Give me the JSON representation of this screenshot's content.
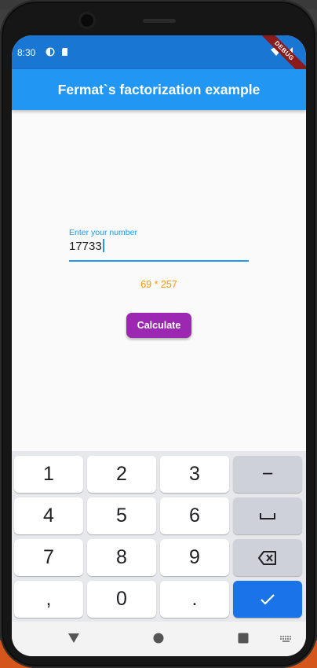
{
  "status_bar": {
    "time": "8:30",
    "debug_banner": "DEBUG"
  },
  "app_bar": {
    "title": "Fermat`s factorization example"
  },
  "number_field": {
    "label": "Enter your number",
    "value": "17733"
  },
  "result": {
    "text": "69 * 257"
  },
  "calculate_button": {
    "label": "Calculate"
  },
  "keyboard": {
    "keys": [
      {
        "label": "1"
      },
      {
        "label": "2"
      },
      {
        "label": "3"
      },
      {
        "label": "−"
      },
      {
        "label": "4"
      },
      {
        "label": "5"
      },
      {
        "label": "6"
      },
      {
        "label": "space",
        "icon": "space-bar-icon"
      },
      {
        "label": "7"
      },
      {
        "label": "8"
      },
      {
        "label": "9"
      },
      {
        "label": "backspace",
        "icon": "backspace-icon"
      },
      {
        "label": ","
      },
      {
        "label": "0"
      },
      {
        "label": "."
      },
      {
        "label": "done",
        "icon": "checkmark-icon"
      }
    ]
  },
  "navigation": {
    "icons": [
      "back-triangle-icon",
      "home-circle-icon",
      "recents-square-icon",
      "keyboard-switch-icon"
    ]
  },
  "colors": {
    "status_bar": "#1976d2",
    "app_bar": "#2196f3",
    "accent": "#2196f3",
    "result": "#ff9800",
    "button": "#9c27b0",
    "done_key": "#1a73e8"
  }
}
